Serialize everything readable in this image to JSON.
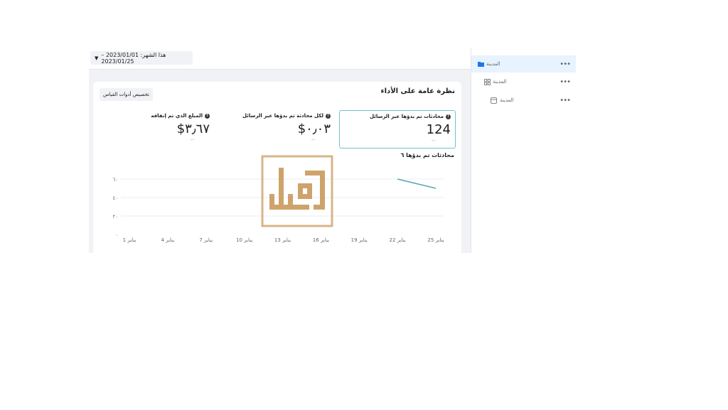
{
  "header": {
    "date_range_label": "هذا الشهر: 2023/01/01 – 2023/01/25",
    "date_caret": "▼"
  },
  "card": {
    "title": "نظرة عامة على الأداء",
    "customize_label": "تخصيص أدوات القياس"
  },
  "metrics": [
    {
      "label": "محادثات تم بدؤها عبر الرسائل",
      "value": "124",
      "delta": "--",
      "selected": true
    },
    {
      "label": "لكل محادثة تم بدؤها عبر الرسائل",
      "value": "٠٫٠٣$",
      "delta": "--",
      "selected": false
    },
    {
      "label": "المبلغ الذي تم إنفاقه",
      "value": "٣٫٦٧$",
      "delta": "--",
      "selected": false
    }
  ],
  "info_glyph": "!",
  "chart_data": {
    "type": "line",
    "title": "محادثات تم بدؤها ٦",
    "categories": [
      "1 يناير",
      "4 يناير",
      "7 يناير",
      "10 يناير",
      "13 يناير",
      "16 يناير",
      "19 يناير",
      "22 يناير",
      "25 يناير"
    ],
    "y_ticks": [
      "٦٠",
      "٤٠",
      "٢٠",
      "٠"
    ],
    "ylim": [
      0,
      60
    ],
    "series": [
      {
        "values": [
          null,
          null,
          null,
          null,
          null,
          null,
          null,
          60,
          50
        ],
        "color": "#5aa8b0"
      }
    ],
    "grid": true
  },
  "sidebar": {
    "items": [
      {
        "label": "المدينة",
        "icon": "folder-icon",
        "active": true
      },
      {
        "label": "المدينة",
        "icon": "grid-icon",
        "active": false
      },
      {
        "label": "المدينة",
        "icon": "ad-icon",
        "active": false
      }
    ],
    "more_glyph": "•••"
  },
  "colors": {
    "accent": "#1877f2",
    "selection_border": "#6fc3ce",
    "logo": "#c99a5b"
  },
  "logo": {
    "icon": "brand-logo-icon"
  }
}
